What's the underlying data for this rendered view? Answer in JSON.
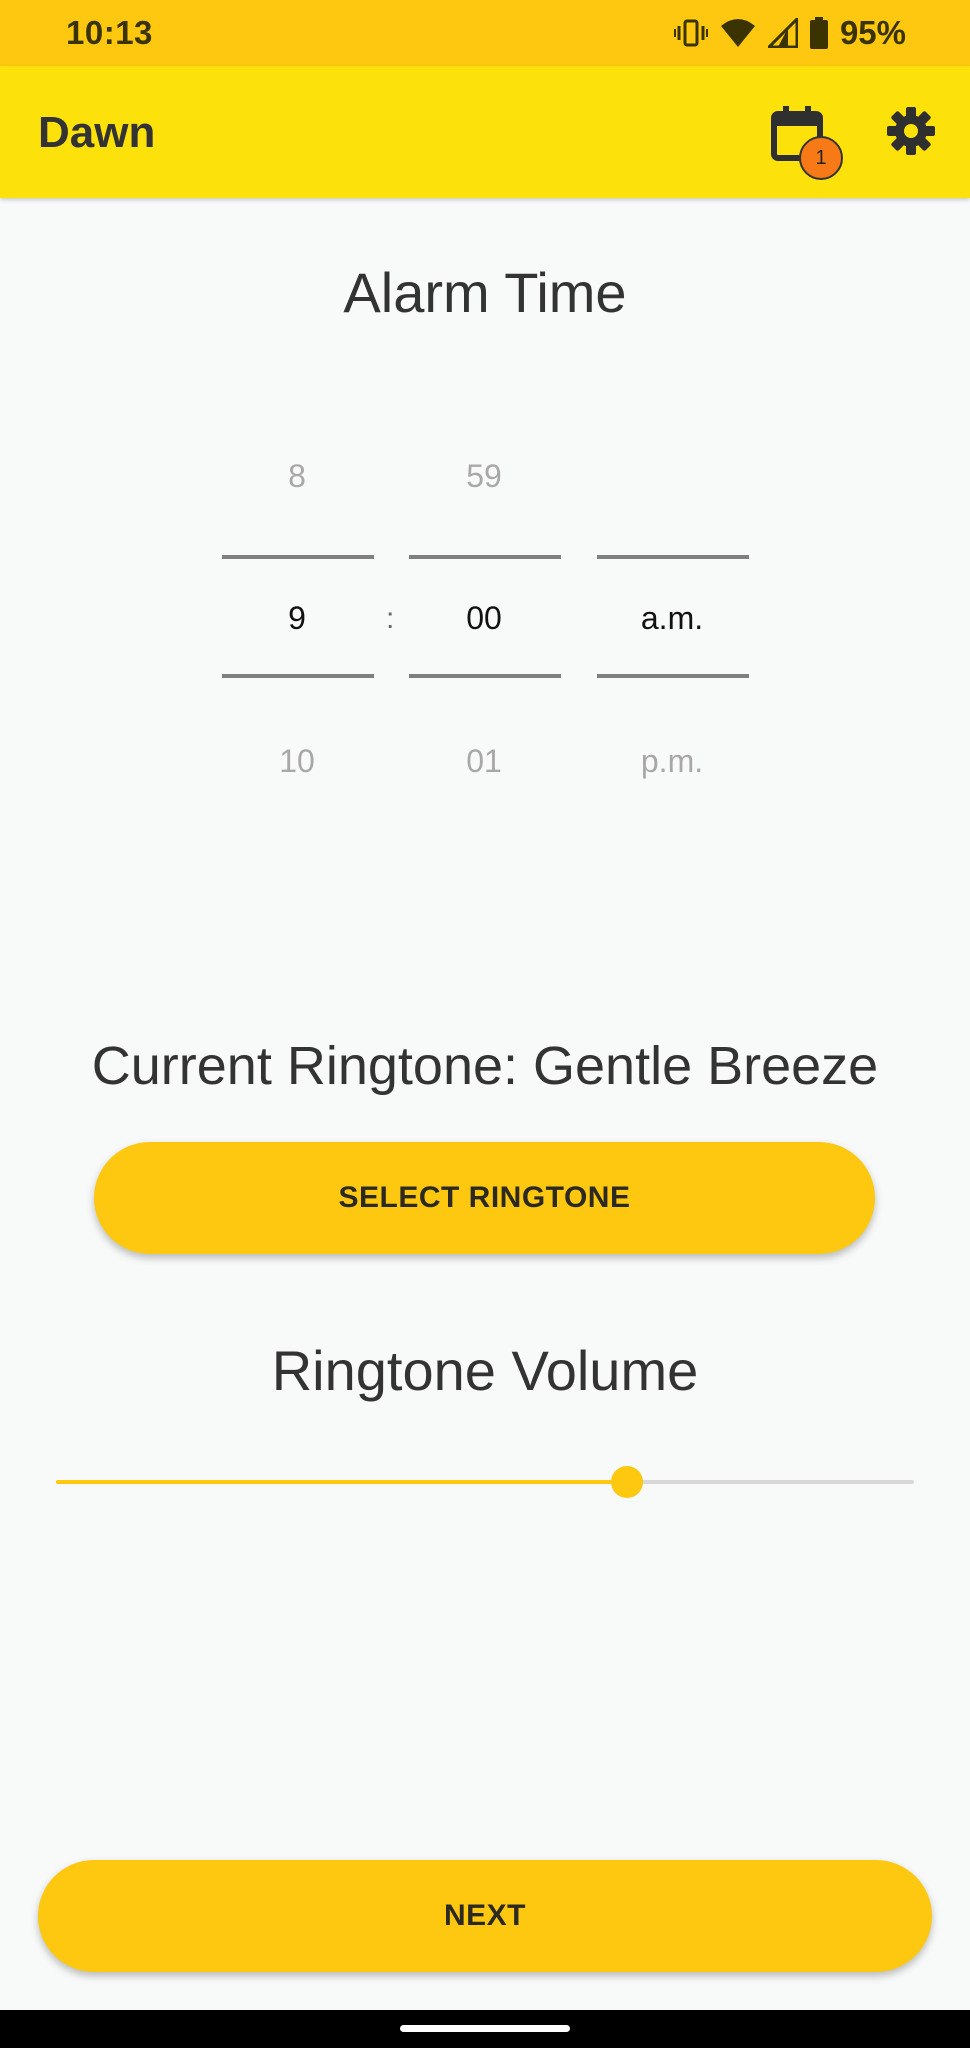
{
  "status_bar": {
    "time": "10:13",
    "battery_percent": "95%",
    "icons": [
      "vibrate-icon",
      "wifi-icon",
      "cell-signal-icon",
      "battery-icon"
    ]
  },
  "app_bar": {
    "title": "Dawn",
    "calendar_badge_count": "1",
    "icons": [
      "calendar-icon",
      "gear-icon"
    ],
    "colors": {
      "bar": "#fde10b",
      "status": "#fdc80f",
      "badge": "#f77a17"
    }
  },
  "alarm": {
    "title": "Alarm Time",
    "hour": {
      "prev": "8",
      "selected": "9",
      "next": "10"
    },
    "separator": ":",
    "minute": {
      "prev": "59",
      "selected": "00",
      "next": "01"
    },
    "period": {
      "prev": "",
      "selected": "a.m.",
      "next": "p.m."
    }
  },
  "ringtone": {
    "current_label": "Current Ringtone: Gentle Breeze",
    "select_button": "SELECT RINGTONE"
  },
  "volume": {
    "title": "Ringtone Volume",
    "level_fraction": 0.666
  },
  "footer": {
    "next_button": "NEXT"
  }
}
